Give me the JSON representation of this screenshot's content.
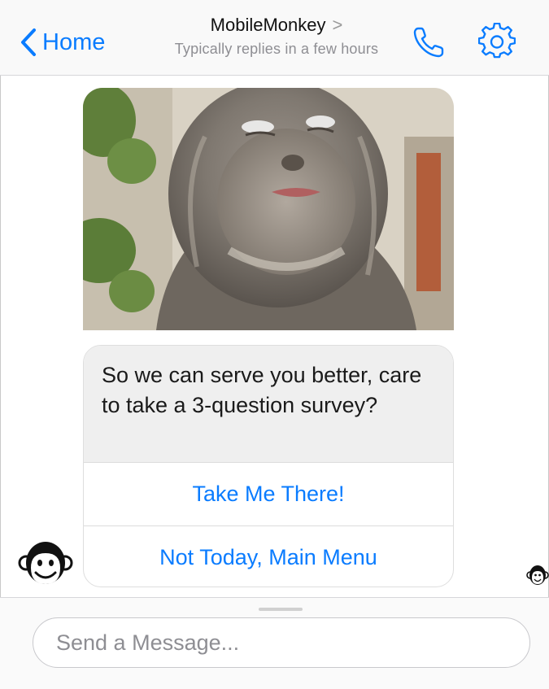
{
  "header": {
    "back_label": "Home",
    "title": "MobileMonkey",
    "title_chevron": ">",
    "subtitle": "Typically replies in a few hours",
    "accent_color": "#0a7cff"
  },
  "message": {
    "text": "So we can serve you better, care to take a 3-question survey?",
    "buttons": [
      {
        "label": "Take Me There!"
      },
      {
        "label": "Not Today, Main Menu"
      }
    ]
  },
  "composer": {
    "placeholder": "Send a Message..."
  },
  "icons": {
    "back": "chevron-left-icon",
    "phone": "phone-icon",
    "settings": "gear-icon",
    "avatar": "monkey-avatar"
  }
}
